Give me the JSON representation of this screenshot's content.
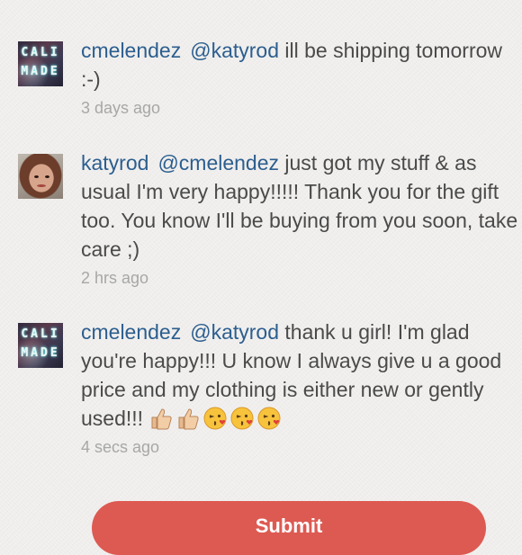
{
  "comments": [
    {
      "avatar_text": "CALI MADE",
      "username": "cmelendez",
      "mention": "@katyrod",
      "text": " ill be shipping tomorrow :-)",
      "time": "3 days ago"
    },
    {
      "username": "katyrod",
      "mention": "@cmelendez",
      "text": " just got my stuff & as usual I'm very happy!!!!! Thank you for the gift too. You know I'll be buying from you soon, take care ;)",
      "time": "2 hrs ago"
    },
    {
      "avatar_text": "CALI MADE",
      "username": "cmelendez",
      "mention": "@katyrod",
      "text": " thank u girl! I'm glad you're happy!!! U know I always give u a good price and my clothing is either new or gently used!!! ",
      "emojis": [
        "thumbs-up-icon",
        "thumbs-up-icon",
        "kiss-face-icon",
        "kiss-face-icon",
        "kiss-face-icon"
      ],
      "time": "4 secs ago"
    }
  ],
  "action_button": {
    "label": "Submit"
  },
  "colors": {
    "username": "#2c5e8f",
    "body_text": "#4a4a4a",
    "timestamp": "#a7a7a7",
    "button": "#dd5a52",
    "background": "#efeeec"
  }
}
